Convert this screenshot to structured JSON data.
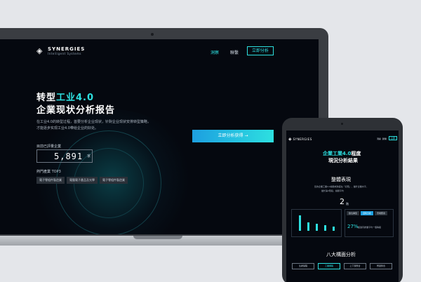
{
  "laptop": {
    "logo": {
      "name": "SYNERGIES",
      "sub": "Intelligent Systems"
    },
    "nav": {
      "link1": "洞察",
      "link2": "聯繫",
      "button": "立即分析"
    },
    "hero": {
      "title_prefix": "转型",
      "title_accent": "工业4.0",
      "title_line2": "企業现状分析报告",
      "description": "在工业4.0的转型过程，首要分析企业现状，针對企业现状安排转型策略，才能逐步实现工业4.0带给企业的好处。"
    },
    "cta": "立即分析获得",
    "counter": {
      "label": "目前已評量企業",
      "value": "5,891",
      "unit": "家"
    },
    "industries": {
      "label": "熱門產業 TOP3",
      "tags": [
        "電子零組件製造業",
        "電腦電子產品及光學",
        "電子零組件製造業"
      ]
    }
  },
  "tablet": {
    "logo": "SYNERGIES",
    "nav": {
      "link1": "洞察",
      "link2": "聯繫",
      "button": "立即"
    },
    "title_accent_line1_prefix": "企業工業4.0",
    "title_line1_suffix": "程度",
    "title_line2": "現況分析結果",
    "overview": {
      "title": "整體表現",
      "desc1": "您的企業工業4.0總體成熟度在「初階」，屬於企業水平，",
      "desc2": "屬於第2階段，總體平均",
      "level": "2",
      "level_unit": "階"
    },
    "panel": {
      "tabs": [
        "數位轉型",
        "資料分析",
        "雲端應用"
      ],
      "percent": "27%",
      "percent_text": "超過同產業平均一個等級"
    },
    "section2": "八大構面分析",
    "buttons": [
      "生產製程",
      "工業網路",
      "上下游整合",
      "營運整合"
    ]
  }
}
